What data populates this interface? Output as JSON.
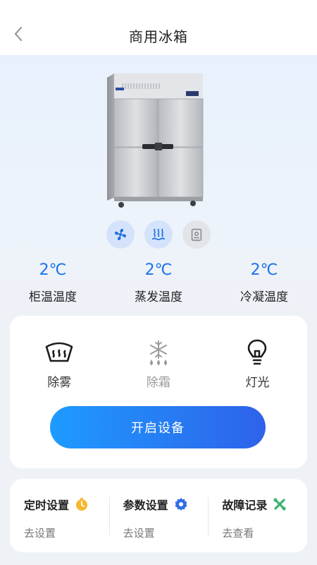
{
  "header": {
    "title": "商用冰箱"
  },
  "device": {
    "modes": [
      {
        "name": "fan-icon",
        "state": "active"
      },
      {
        "name": "heat-waves-icon",
        "state": "active"
      },
      {
        "name": "clipboard-icon",
        "state": "inactive"
      }
    ],
    "temps": [
      {
        "value": "2℃",
        "label": "柜温温度"
      },
      {
        "value": "2℃",
        "label": "蒸发温度"
      },
      {
        "value": "2℃",
        "label": "冷凝温度"
      }
    ]
  },
  "functions": [
    {
      "label": "除雾",
      "icon": "defog-icon",
      "enabled": true
    },
    {
      "label": "除霜",
      "icon": "snowflake-icon",
      "enabled": false
    },
    {
      "label": "灯光",
      "icon": "lightbulb-icon",
      "enabled": true
    }
  ],
  "start_button": {
    "label": "开启设备"
  },
  "shortcuts": [
    {
      "title": "定时设置",
      "sub": "去设置",
      "icon": "timer-icon",
      "color": "#f5b82e"
    },
    {
      "title": "参数设置",
      "sub": "去设置",
      "icon": "gear-icon",
      "color": "#2f6fe8"
    },
    {
      "title": "故障记录",
      "sub": "去查看",
      "icon": "wrench-icon",
      "color": "#3cb371"
    }
  ],
  "colors": {
    "accent": "#1a73e8",
    "button_start": "#1e9bff",
    "button_end": "#2e62ea"
  }
}
